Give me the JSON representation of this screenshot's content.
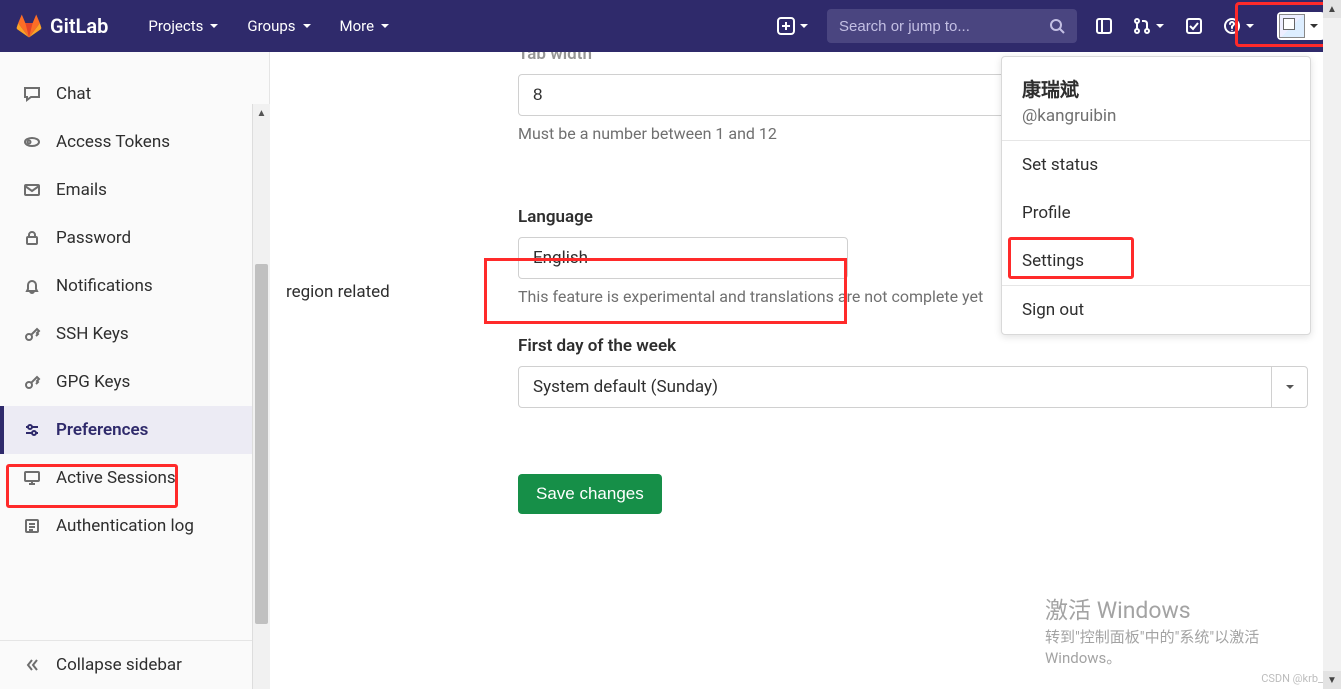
{
  "brand": "GitLab",
  "nav": {
    "projects": "Projects",
    "groups": "Groups",
    "more": "More"
  },
  "search": {
    "placeholder": "Search or jump to..."
  },
  "sidebar": {
    "items": [
      {
        "label": "Chat"
      },
      {
        "label": "Access Tokens"
      },
      {
        "label": "Emails"
      },
      {
        "label": "Password"
      },
      {
        "label": "Notifications"
      },
      {
        "label": "SSH Keys"
      },
      {
        "label": "GPG Keys"
      },
      {
        "label": "Preferences"
      },
      {
        "label": "Active Sessions"
      },
      {
        "label": "Authentication log"
      }
    ],
    "collapse": "Collapse sidebar"
  },
  "section_side_text": "region related",
  "tab_width": {
    "label": "Tab width",
    "value": "8",
    "hint": "Must be a number between 1 and 12"
  },
  "language": {
    "label": "Language",
    "value": "English",
    "hint": "This feature is experimental and translations are not complete yet"
  },
  "first_day": {
    "label": "First day of the week",
    "value": "System default (Sunday)"
  },
  "save_label": "Save changes",
  "user_menu": {
    "name": "康瑞斌",
    "handle": "@kangruibin",
    "set_status": "Set status",
    "profile": "Profile",
    "settings": "Settings",
    "sign_out": "Sign out"
  },
  "watermark": {
    "title": "激活 Windows",
    "body": "转到\"控制面板\"中的\"系统\"以激活 Windows。"
  },
  "csdn": "CSDN @krb_"
}
